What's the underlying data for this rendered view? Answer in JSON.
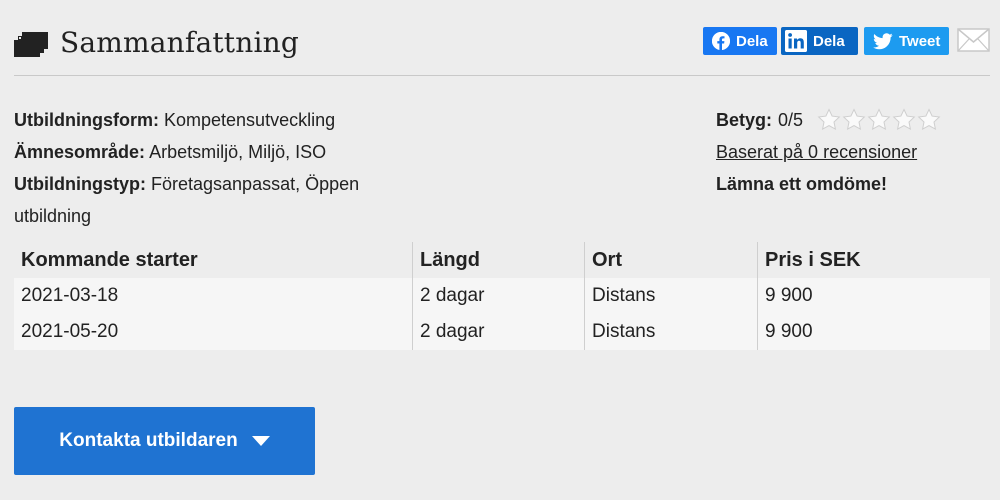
{
  "header": {
    "title": "Sammanfattning",
    "title_icon": "stacked-pages-icon"
  },
  "share": {
    "facebook": {
      "label": "Dela",
      "icon": "facebook-icon",
      "color": "#1877f2"
    },
    "linkedin": {
      "label": "Dela",
      "icon": "linkedin-icon",
      "color": "#0a66c2"
    },
    "twitter": {
      "label": "Tweet",
      "icon": "twitter-icon",
      "color": "#1d9bf0"
    },
    "email": {
      "icon": "envelope-icon"
    }
  },
  "details": {
    "utbildningsform_label": "Utbildningsform:",
    "utbildningsform_value": "Kompetensutveckling",
    "amnesomrade_label": "Ämnesområde:",
    "amnesomrade_value": "Arbetsmiljö, Miljö, ISO",
    "utbildningstyp_label": "Utbildningstyp:",
    "utbildningstyp_value": "Företagsanpassat, Öppen utbildning"
  },
  "rating": {
    "label": "Betyg:",
    "value": "0/5",
    "stars_filled": 0,
    "stars_total": 5,
    "reviews_link": "Baserat på 0 recensioner",
    "leave_review": "Lämna ett omdöme!"
  },
  "table": {
    "headers": [
      "Kommande starter",
      "Längd",
      "Ort",
      "Pris i SEK"
    ],
    "rows": [
      [
        "2021-03-18",
        "2 dagar",
        "Distans",
        "9 900"
      ],
      [
        "2021-05-20",
        "2 dagar",
        "Distans",
        "9 900"
      ]
    ]
  },
  "cta": {
    "label": "Kontakta utbildaren",
    "color": "#1f73d2"
  }
}
